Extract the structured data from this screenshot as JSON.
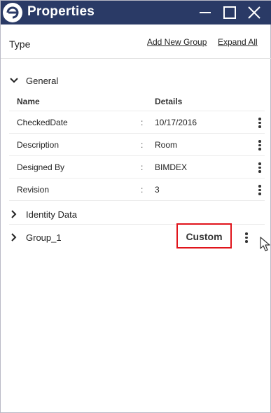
{
  "window": {
    "title": "Properties",
    "brand_color": "#2a3a66",
    "icons": {
      "logo": "app-logo-icon",
      "minimize": "minimize-icon",
      "maximize": "maximize-icon",
      "close": "close-icon"
    }
  },
  "header": {
    "type_label": "Type",
    "add_group_link": "Add New Group",
    "expand_all_link": "Expand All"
  },
  "general": {
    "label": "General",
    "expanded": true,
    "columns": {
      "name": "Name",
      "details": "Details"
    },
    "separator": ":",
    "rows": [
      {
        "name": "CheckedDate",
        "value": "10/17/2016"
      },
      {
        "name": "Description",
        "value": "Room"
      },
      {
        "name": "Designed By",
        "value": "BIMDEX"
      },
      {
        "name": "Revision",
        "value": "3"
      }
    ]
  },
  "groups": [
    {
      "label": "Identity Data",
      "expanded": false
    },
    {
      "label": "Group_1",
      "expanded": false,
      "badge": "Custom",
      "badge_highlight_color": "#e0141b"
    }
  ]
}
